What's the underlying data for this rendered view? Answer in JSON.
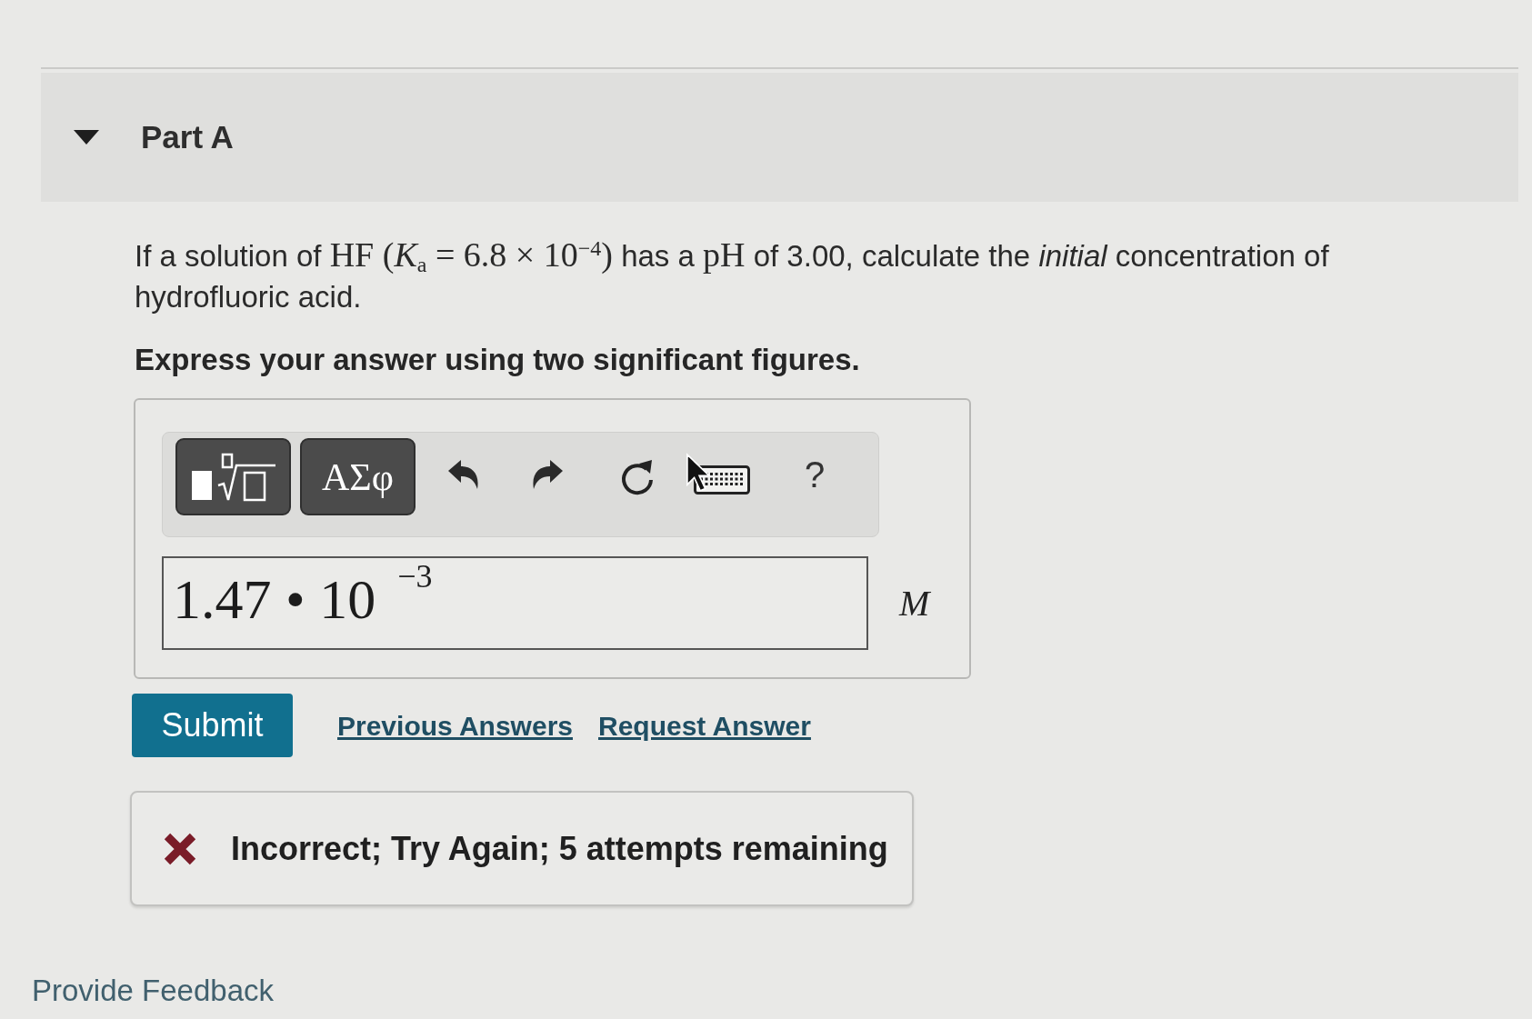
{
  "part": {
    "title": "Part A",
    "expanded": true
  },
  "question": {
    "segments": [
      {
        "kind": "text",
        "text": "If a solution of "
      },
      {
        "kind": "math",
        "text": "HF  (*K*$_{a}$ = 6.8 × 10$^{−4}$)"
      },
      {
        "kind": "text",
        "text": " has a "
      },
      {
        "kind": "math",
        "text": "pH"
      },
      {
        "kind": "text",
        "text": " of 3.00, calculate the *initial* concentration of hydrofluoric acid."
      }
    ]
  },
  "instruction": "Express your answer using two significant figures.",
  "answer": {
    "toolbar": [
      {
        "kind": "templates"
      },
      {
        "kind": "symbols",
        "label": "ΑΣφ"
      },
      {
        "kind": "undo"
      },
      {
        "kind": "redo"
      },
      {
        "kind": "reset"
      },
      {
        "kind": "keyboard"
      },
      {
        "kind": "help",
        "label": "?"
      }
    ],
    "value": "1.47 • 10$^{−3}$",
    "unit": "M"
  },
  "actions": {
    "submit": "Submit",
    "links": [
      "Previous Answers",
      "Request Answer"
    ]
  },
  "feedback": {
    "correct": false,
    "text": "Incorrect; Try Again; 5 attempts remaining"
  },
  "footer_link": "Provide Feedback"
}
